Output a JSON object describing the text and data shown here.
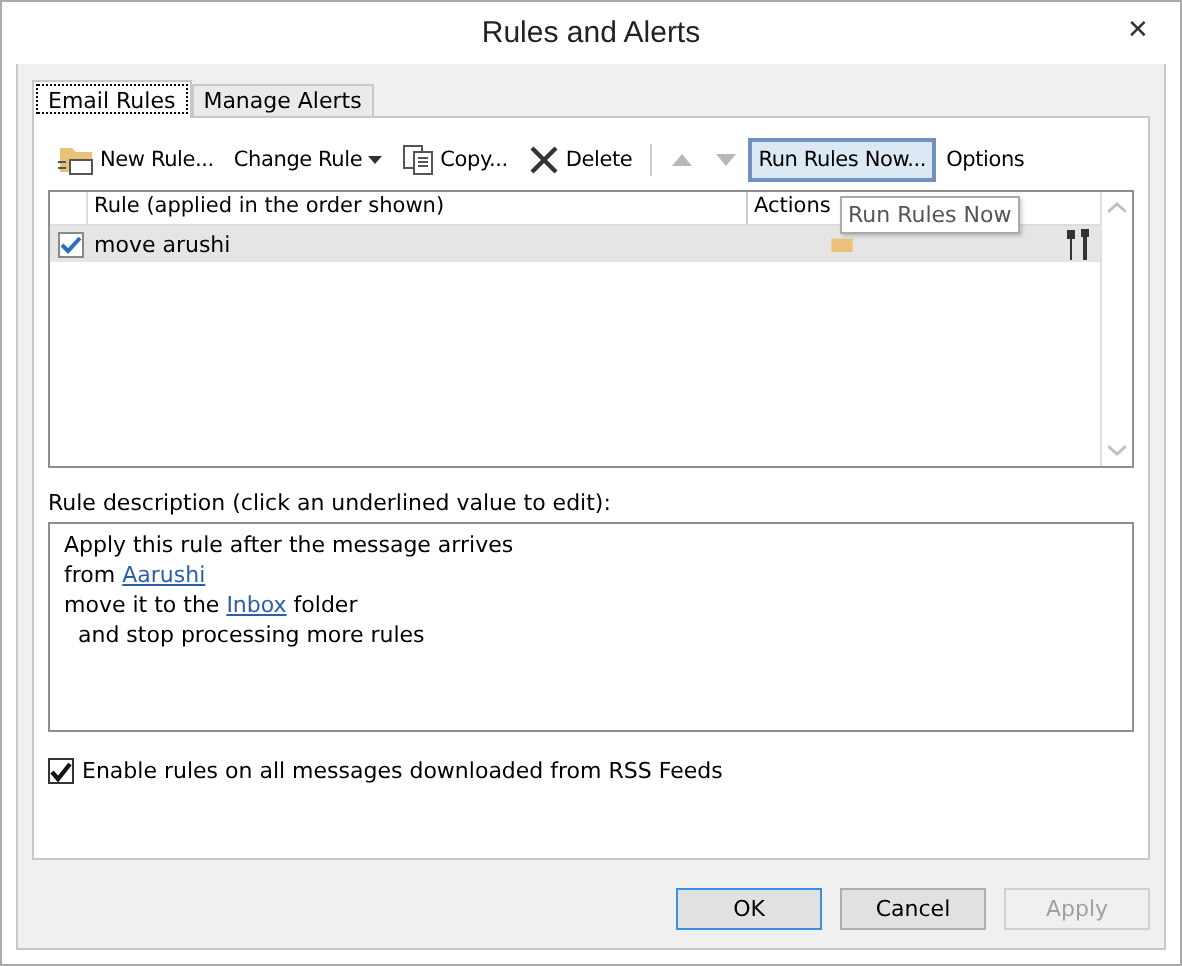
{
  "window": {
    "title": "Rules and Alerts",
    "close": "✕"
  },
  "tabs": [
    {
      "label": "Email Rules",
      "selected": true
    },
    {
      "label": "Manage Alerts",
      "selected": false
    }
  ],
  "toolbar": [
    {
      "kind": "new",
      "label": "New Rule...",
      "highlighted": false,
      "disabled": false
    },
    {
      "kind": "change",
      "label": "Change Rule",
      "highlighted": false,
      "disabled": false
    },
    {
      "kind": "copy",
      "label": "Copy...",
      "highlighted": false,
      "disabled": false
    },
    {
      "kind": "delete",
      "label": "Delete",
      "highlighted": false,
      "disabled": false
    },
    {
      "kind": "up",
      "highlighted": false,
      "disabled": true
    },
    {
      "kind": "down",
      "highlighted": false,
      "disabled": true
    },
    {
      "kind": "text",
      "label": "Run Rules Now...",
      "highlighted": true,
      "disabled": false
    },
    {
      "kind": "text",
      "label": "Options",
      "highlighted": false,
      "disabled": false
    }
  ],
  "table": {
    "columns": [
      "Rule (applied in the order shown)",
      "Actions"
    ],
    "rows": [
      {
        "name": "move arushi",
        "checked": true,
        "selected": true
      }
    ]
  },
  "tooltip": "Run Rules Now",
  "description": {
    "label": "Rule description (click an underlined value to edit):",
    "lines": [
      [
        {
          "text": "Apply this rule after the message arrives",
          "link": false
        }
      ],
      [
        {
          "text": "from ",
          "link": false
        },
        {
          "text": "Aarushi",
          "link": true
        }
      ],
      [
        {
          "text": "move it to the ",
          "link": false
        },
        {
          "text": "Inbox",
          "link": true
        },
        {
          "text": " folder",
          "link": false
        }
      ],
      [
        {
          "text": "  and stop processing more rules",
          "link": false
        }
      ]
    ]
  },
  "rss": {
    "label": "Enable rules on all messages downloaded from RSS Feeds",
    "checked": true
  },
  "buttons": [
    {
      "label": "OK",
      "default": true,
      "disabled": false
    },
    {
      "label": "Cancel",
      "default": false,
      "disabled": false
    },
    {
      "label": "Apply",
      "default": false,
      "disabled": true
    }
  ]
}
